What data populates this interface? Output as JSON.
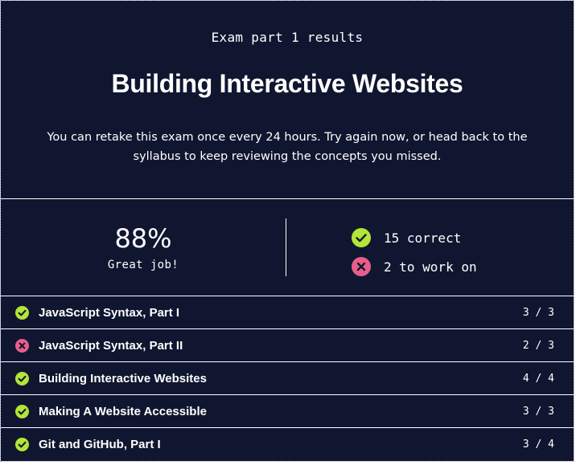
{
  "header": {
    "eyebrow": "Exam part 1 results",
    "title": "Building Interactive Websites",
    "description": "You can retake this exam once every 24 hours. Try again now, or head back to the syllabus to keep reviewing the concepts you missed."
  },
  "summary": {
    "score": "88%",
    "praise": "Great job!",
    "correct_label": "15 correct",
    "incorrect_label": "2 to work on"
  },
  "topics": [
    {
      "name": "JavaScript Syntax, Part I",
      "score": "3 / 3",
      "status": "check-icon"
    },
    {
      "name": "JavaScript Syntax, Part II",
      "score": "2 / 3",
      "status": "x-icon"
    },
    {
      "name": "Building Interactive Websites",
      "score": "4 / 4",
      "status": "check-icon"
    },
    {
      "name": "Making A Website Accessible",
      "score": "3 / 3",
      "status": "check-icon"
    },
    {
      "name": "Git and GitHub, Part I",
      "score": "3 / 4",
      "status": "check-icon"
    }
  ],
  "colors": {
    "background": "#10162f",
    "correct": "#b3e438",
    "incorrect": "#e85d8a",
    "text": "#ffffff"
  }
}
